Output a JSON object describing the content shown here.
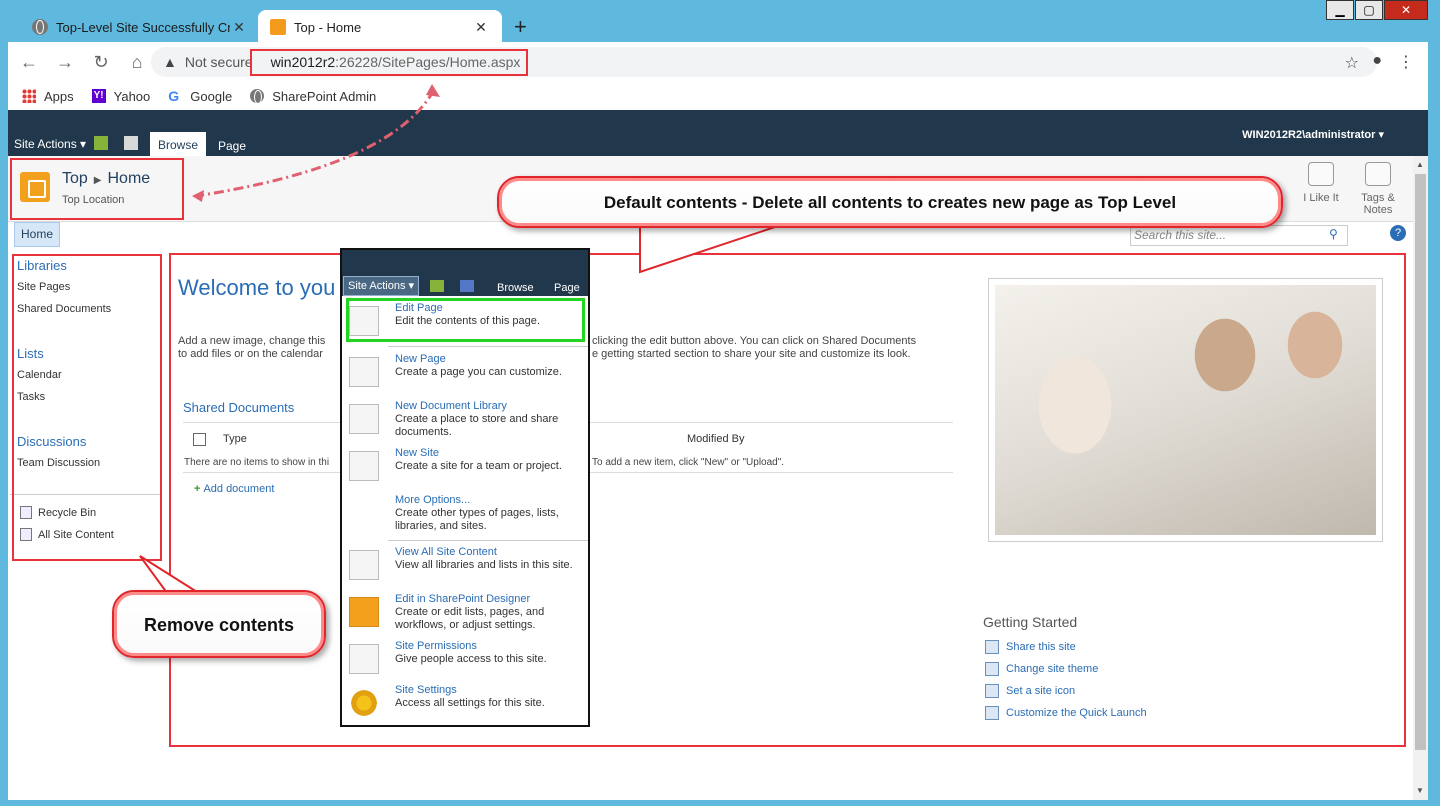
{
  "browser": {
    "tabs": [
      {
        "title": "Top-Level Site Successfully Creat",
        "active": false
      },
      {
        "title": "Top - Home",
        "active": true
      }
    ],
    "new_tab": "+",
    "close_glyph": "✕",
    "security_label": "Not secure",
    "url_host": "win2012r2",
    "url_path": ":26228/SitePages/Home.aspx",
    "bookmarks": [
      "Apps",
      "Yahoo",
      "Google",
      "SharePoint Admin"
    ]
  },
  "ribbon": {
    "site_actions": "Site Actions",
    "tabs": [
      "Browse",
      "Page"
    ],
    "user": "WIN2012R2\\administrator"
  },
  "title_area": {
    "site": "Top",
    "page": "Home",
    "subtitle": "Top Location",
    "social": [
      "I Like It",
      "Tags & Notes"
    ]
  },
  "topnav": {
    "home": "Home",
    "search_placeholder": "Search this site..."
  },
  "quicklaunch": {
    "sections": [
      {
        "heading": "Libraries",
        "items": [
          "Site Pages",
          "Shared Documents"
        ]
      },
      {
        "heading": "Lists",
        "items": [
          "Calendar",
          "Tasks"
        ]
      },
      {
        "heading": "Discussions",
        "items": [
          "Team Discussion"
        ]
      }
    ],
    "footer": [
      "Recycle Bin",
      "All Site Content"
    ]
  },
  "content": {
    "welcome": "Welcome to you",
    "intro_left_1": "Add a new image, change this",
    "intro_left_2": "to add files or on the calendar",
    "intro_right_1": "clicking the edit button above. You can click on Shared Documents",
    "intro_right_2": "e getting started section to share your site and customize its look.",
    "shared_docs_title": "Shared Documents",
    "col_type": "Type",
    "col_modified_by": "Modified By",
    "empty_left": "There are no items to show in thi",
    "empty_right": "To add a new item, click \"New\" or \"Upload\".",
    "add_document": "Add document",
    "getting_started": {
      "title": "Getting Started",
      "items": [
        "Share this site",
        "Change site theme",
        "Set a site icon",
        "Customize the Quick Launch"
      ]
    }
  },
  "menu": {
    "header": {
      "site_actions": "Site Actions",
      "browse": "Browse",
      "page": "Page"
    },
    "items": [
      {
        "title": "Edit Page",
        "desc": "Edit the contents of this page."
      },
      {
        "title": "New Page",
        "desc": "Create a page you can customize."
      },
      {
        "title": "New Document Library",
        "desc": "Create a place to store and share documents."
      },
      {
        "title": "New Site",
        "desc": "Create a site for a team or project."
      },
      {
        "title": "More Options...",
        "desc": "Create other types of pages, lists, libraries, and sites."
      },
      {
        "title": "View All Site Content",
        "desc": "View all libraries and lists in this site."
      },
      {
        "title": "Edit in SharePoint Designer",
        "desc": "Create or edit lists, pages, and workflows, or adjust settings."
      },
      {
        "title": "Site Permissions",
        "desc": "Give people access to this site."
      },
      {
        "title": "Site Settings",
        "desc": "Access all settings for this site."
      }
    ]
  },
  "callouts": {
    "top": "Default contents - Delete all contents to creates new page as Top Level",
    "left": "Remove contents"
  },
  "colors": {
    "annotation_red": "#e8333c",
    "edit_highlight_green": "#23d423",
    "ribbon_dark": "#21374c",
    "link_blue": "#2a6db5"
  }
}
